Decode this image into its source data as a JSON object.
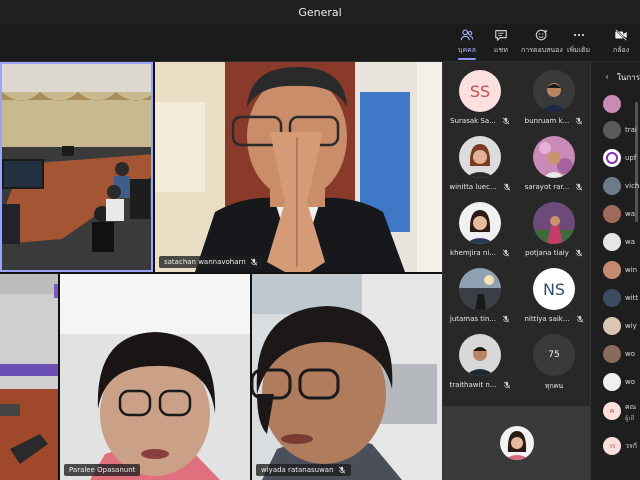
{
  "window": {
    "title": "General"
  },
  "toolbar": {
    "people_label": "บุคคล",
    "chat_label": "แชท",
    "reactions_label": "การตอบสนอง",
    "more_label": "เพิ่มเติม",
    "camera_label": "กล้อง"
  },
  "stage": {
    "tiles": [
      {
        "name": ""
      },
      {
        "name": "satachan wannavoharn"
      },
      {
        "name": ""
      },
      {
        "name": "Paralee Opasanunt"
      },
      {
        "name": "wiyada ratanasuwan"
      }
    ]
  },
  "roster": {
    "people": [
      {
        "name": "Surasak Sa...",
        "initials": "SS"
      },
      {
        "name": "bunruam k..."
      },
      {
        "name": "winitta luec..."
      },
      {
        "name": "sarayot rar..."
      },
      {
        "name": "khemjira ni..."
      },
      {
        "name": "potjana tiaiy"
      },
      {
        "name": "jutamas tin..."
      },
      {
        "name": "nittiya saik...",
        "initials": "NS"
      },
      {
        "name": "traithawit n..."
      },
      {
        "name": "ทุกคน",
        "count": "75"
      }
    ]
  },
  "chat": {
    "title": "ในการ",
    "rows": [
      {
        "text": "trai",
        "initial": ""
      },
      {
        "text": "upf",
        "initial": ""
      },
      {
        "text": "vich",
        "initial": ""
      },
      {
        "text": "wa",
        "initial": ""
      },
      {
        "text": "wa",
        "initial": ""
      },
      {
        "text": "win",
        "initial": ""
      },
      {
        "text": "witt",
        "initial": ""
      },
      {
        "text": "wiy",
        "initial": ""
      },
      {
        "text": "wo",
        "initial": ""
      },
      {
        "text": "wo",
        "initial": ""
      },
      {
        "text": "คณ",
        "sub": "ผู้เยี่",
        "initial": "ค"
      },
      {
        "text": "วรกั",
        "initial": "วร"
      }
    ]
  },
  "colors": {
    "accent": "#8b95f5",
    "tile_border_active": "#9aa4ff",
    "initials_bg": "#fbe0df",
    "initials_fg": "#c5504a",
    "ns_bg": "#ffffff",
    "ns_fg": "#31506b"
  }
}
